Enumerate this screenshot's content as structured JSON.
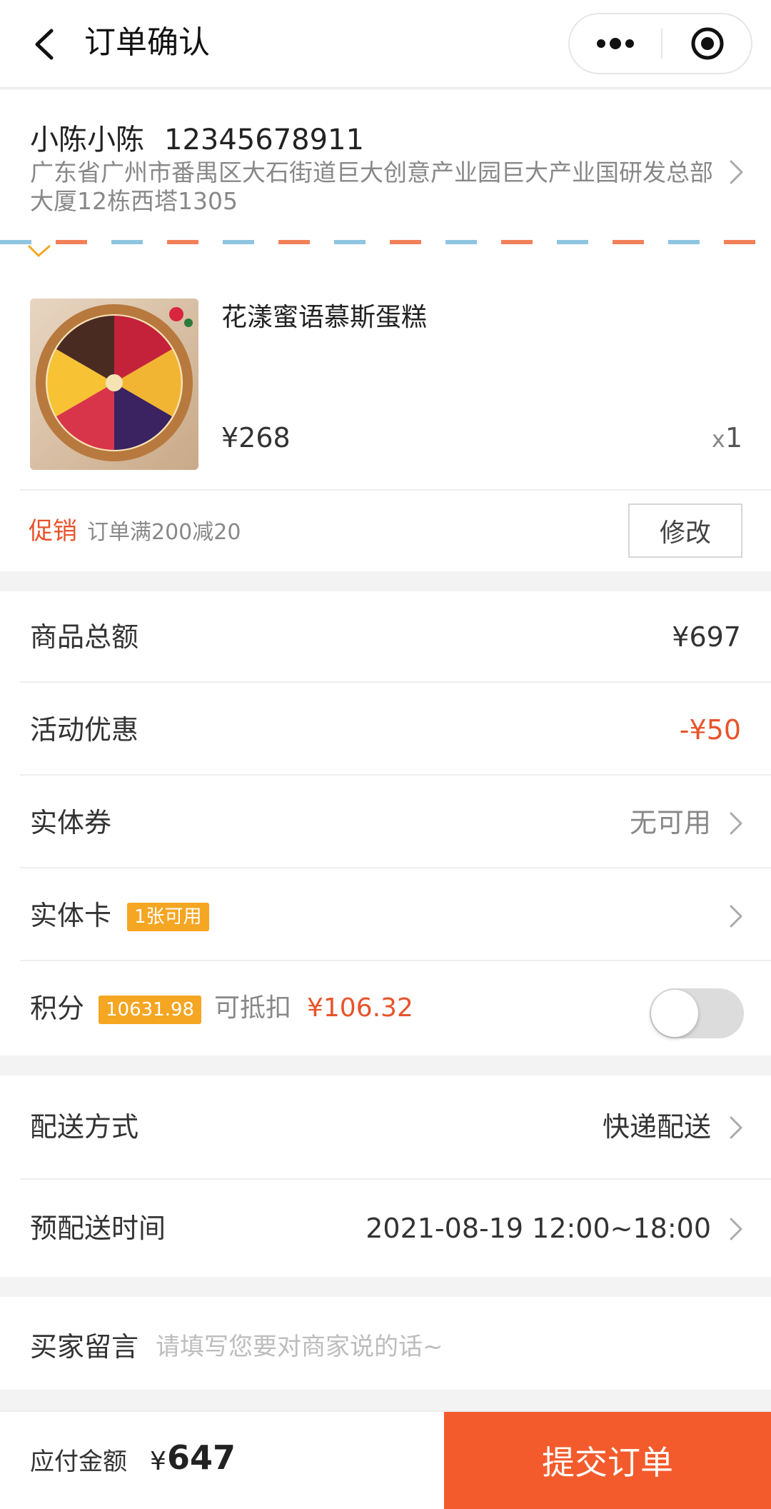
{
  "nav": {
    "title": "订单确认",
    "back_icon": "chevron-left-icon",
    "more_icon": "more-dots-icon",
    "close_icon": "target-circle-icon"
  },
  "address": {
    "name": "小陈小陈",
    "phone": "12345678911",
    "detail": "广东省广州市番禺区大石街道巨大创意产业园巨大产业国研发总部大厦12栋西塔1305"
  },
  "product": {
    "name": "花漾蜜语慕斯蛋糕",
    "price": "¥268",
    "qty_prefix": "x",
    "qty": "1"
  },
  "promotion": {
    "tag": "促销",
    "description": "订单满200减20",
    "modify_label": "修改"
  },
  "summary": {
    "total_label": "商品总额",
    "total_value": "¥697",
    "discount_label": "活动优惠",
    "discount_value": "-¥50",
    "voucher_label": "实体券",
    "voucher_value": "无可用",
    "card_label": "实体卡",
    "card_badge": "1张可用",
    "points_label": "积分",
    "points_badge": "10631.98",
    "points_deduct_label": "可抵扣",
    "points_deduct_value": "¥106.32",
    "points_toggle_on": false
  },
  "delivery": {
    "method_label": "配送方式",
    "method_value": "快递配送",
    "time_label": "预配送时间",
    "time_value": "2021-08-19 12:00~18:00"
  },
  "message": {
    "label": "买家留言",
    "placeholder": "请填写您要对商家说的话~"
  },
  "footer": {
    "pay_label": "应付金额",
    "currency": "¥",
    "pay_amount": "647",
    "submit_label": "提交订单"
  },
  "colors": {
    "accent": "#f45b2c",
    "promo": "#e8532b",
    "badge": "#f5a623"
  }
}
